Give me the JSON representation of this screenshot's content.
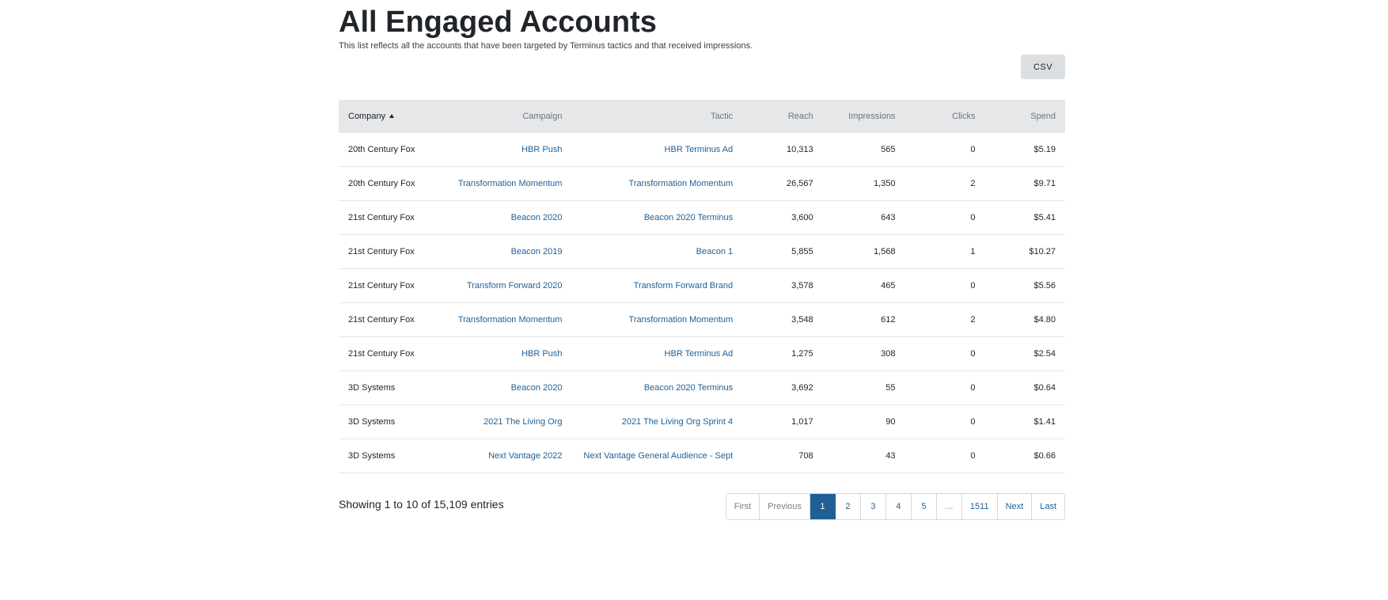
{
  "page": {
    "title": "All Engaged Accounts",
    "description": "This list reflects all the accounts that have been targeted by Terminus tactics and that received impressions."
  },
  "toolbar": {
    "csv_label": "CSV"
  },
  "table": {
    "columns": [
      "Company",
      "Campaign",
      "Tactic",
      "Reach",
      "Impressions",
      "Clicks",
      "Spend"
    ],
    "sort": {
      "column": "Company",
      "direction": "ascending"
    },
    "rows": [
      {
        "company": "20th Century Fox",
        "campaign": "HBR Push",
        "tactic": "HBR Terminus Ad",
        "reach": "10,313",
        "impressions": "565",
        "clicks": "0",
        "spend": "$5.19"
      },
      {
        "company": "20th Century Fox",
        "campaign": "Transformation Momentum",
        "tactic": "Transformation Momentum",
        "reach": "26,567",
        "impressions": "1,350",
        "clicks": "2",
        "spend": "$9.71"
      },
      {
        "company": "21st Century Fox",
        "campaign": "Beacon 2020",
        "tactic": "Beacon 2020 Terminus",
        "reach": "3,600",
        "impressions": "643",
        "clicks": "0",
        "spend": "$5.41"
      },
      {
        "company": "21st Century Fox",
        "campaign": "Beacon 2019",
        "tactic": "Beacon 1",
        "reach": "5,855",
        "impressions": "1,568",
        "clicks": "1",
        "spend": "$10.27"
      },
      {
        "company": "21st Century Fox",
        "campaign": "Transform Forward 2020",
        "tactic": "Transform Forward Brand",
        "reach": "3,578",
        "impressions": "465",
        "clicks": "0",
        "spend": "$5.56"
      },
      {
        "company": "21st Century Fox",
        "campaign": "Transformation Momentum",
        "tactic": "Transformation Momentum",
        "reach": "3,548",
        "impressions": "612",
        "clicks": "2",
        "spend": "$4.80"
      },
      {
        "company": "21st Century Fox",
        "campaign": "HBR Push",
        "tactic": "HBR Terminus Ad",
        "reach": "1,275",
        "impressions": "308",
        "clicks": "0",
        "spend": "$2.54"
      },
      {
        "company": "3D Systems",
        "campaign": "Beacon 2020",
        "tactic": "Beacon 2020 Terminus",
        "reach": "3,692",
        "impressions": "55",
        "clicks": "0",
        "spend": "$0.64"
      },
      {
        "company": "3D Systems",
        "campaign": "2021 The Living Org",
        "tactic": "2021 The Living Org Sprint 4",
        "reach": "1,017",
        "impressions": "90",
        "clicks": "0",
        "spend": "$1.41"
      },
      {
        "company": "3D Systems",
        "campaign": "Next Vantage 2022",
        "tactic": "Next Vantage General Audience - Sept",
        "reach": "708",
        "impressions": "43",
        "clicks": "0",
        "spend": "$0.66"
      }
    ]
  },
  "footer": {
    "entries_info": "Showing 1 to 10 of 15,109 entries"
  },
  "pagination": {
    "first": "First",
    "previous": "Previous",
    "pages": [
      "1",
      "2",
      "3",
      "4",
      "5"
    ],
    "ellipsis": "…",
    "last_page": "1511",
    "next": "Next",
    "last": "Last",
    "current": "1"
  },
  "colors": {
    "link": "#1f5f95",
    "header_bg": "#e5e7e9",
    "active_page_bg": "#1f5f95",
    "csv_button_bg": "#dcdfe2"
  }
}
